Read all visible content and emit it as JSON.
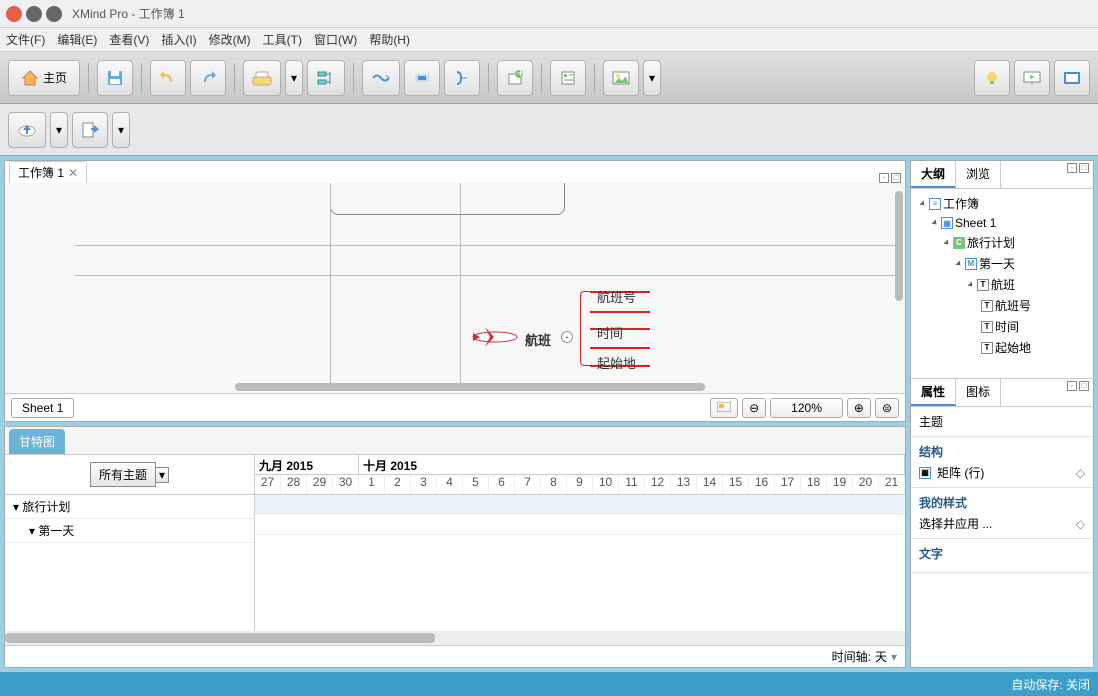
{
  "window": {
    "title": "XMind Pro - 工作簿 1"
  },
  "menu": {
    "file": "文件(F)",
    "edit": "编辑(E)",
    "view": "查看(V)",
    "insert": "插入(I)",
    "modify": "修改(M)",
    "tools": "工具(T)",
    "window": "窗口(W)",
    "help": "帮助(H)"
  },
  "toolbar": {
    "home": "主页"
  },
  "editor": {
    "tab": "工作簿 1",
    "sheet_tab": "Sheet 1",
    "zoom": "120%",
    "nodes": {
      "main": "航班",
      "sub1": "航班号",
      "sub2": "时间",
      "sub3": "起始地"
    }
  },
  "gantt": {
    "tab": "甘特图",
    "filter": "所有主题",
    "months": {
      "sep": "九月 2015",
      "oct": "十月 2015"
    },
    "days": [
      "27",
      "28",
      "29",
      "30",
      "1",
      "2",
      "3",
      "4",
      "5",
      "6",
      "7",
      "8",
      "9",
      "10",
      "11",
      "12",
      "13",
      "14",
      "15",
      "16",
      "17",
      "18",
      "19",
      "20",
      "21"
    ],
    "tree": {
      "item0": "旅行计划",
      "item1": "第一天"
    },
    "footer": {
      "axis_label": "时间轴:",
      "unit": "天"
    }
  },
  "outline": {
    "tabs": {
      "outline": "大纲",
      "browse": "浏览"
    },
    "items": {
      "workbook": "工作簿",
      "sheet": "Sheet 1",
      "plan": "旅行计划",
      "day1": "第一天",
      "flight": "航班",
      "flightno": "航班号",
      "time": "时间",
      "origin": "起始地"
    }
  },
  "props": {
    "tabs": {
      "props": "属性",
      "icons": "图标"
    },
    "subject": "主题",
    "structure_label": "结构",
    "structure_value": "矩阵 (行)",
    "mystyle_label": "我的样式",
    "mystyle_value": "选择并应用 ...",
    "text_label": "文字"
  },
  "statusbar": {
    "autosave": "自动保存: 关闭"
  }
}
